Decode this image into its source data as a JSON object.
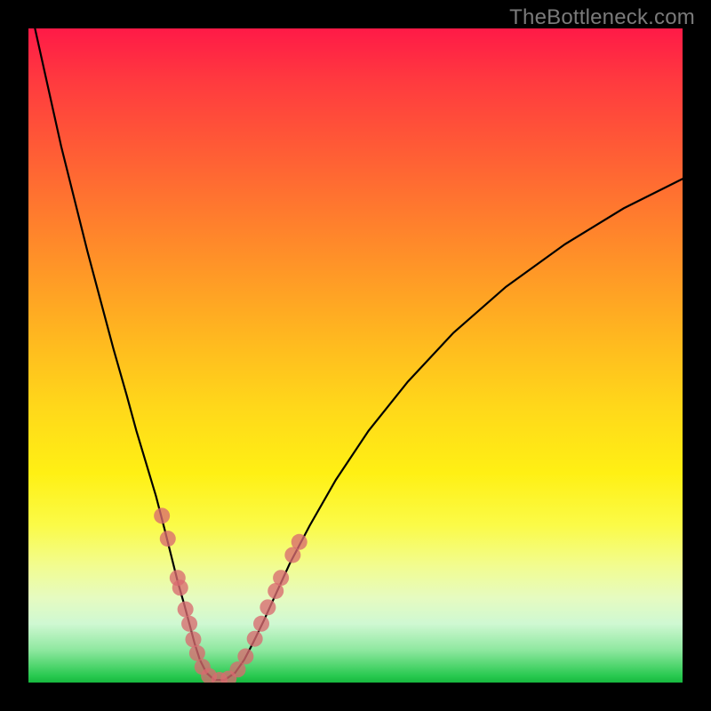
{
  "watermark": "TheBottleneck.com",
  "chart_data": {
    "type": "line",
    "title": "",
    "xlabel": "",
    "ylabel": "",
    "x_range": [
      0,
      1
    ],
    "y_range": [
      0,
      1
    ],
    "curve": [
      {
        "x": 0.01,
        "y": 1.0
      },
      {
        "x": 0.03,
        "y": 0.91
      },
      {
        "x": 0.05,
        "y": 0.82
      },
      {
        "x": 0.07,
        "y": 0.74
      },
      {
        "x": 0.09,
        "y": 0.66
      },
      {
        "x": 0.11,
        "y": 0.585
      },
      {
        "x": 0.13,
        "y": 0.51
      },
      {
        "x": 0.15,
        "y": 0.44
      },
      {
        "x": 0.165,
        "y": 0.385
      },
      {
        "x": 0.18,
        "y": 0.335
      },
      {
        "x": 0.195,
        "y": 0.285
      },
      {
        "x": 0.208,
        "y": 0.235
      },
      {
        "x": 0.218,
        "y": 0.195
      },
      {
        "x": 0.228,
        "y": 0.155
      },
      {
        "x": 0.238,
        "y": 0.12
      },
      {
        "x": 0.246,
        "y": 0.09
      },
      {
        "x": 0.254,
        "y": 0.06
      },
      {
        "x": 0.262,
        "y": 0.035
      },
      {
        "x": 0.272,
        "y": 0.015
      },
      {
        "x": 0.284,
        "y": 0.004
      },
      {
        "x": 0.3,
        "y": 0.004
      },
      {
        "x": 0.316,
        "y": 0.015
      },
      {
        "x": 0.33,
        "y": 0.035
      },
      {
        "x": 0.344,
        "y": 0.062
      },
      {
        "x": 0.36,
        "y": 0.095
      },
      {
        "x": 0.378,
        "y": 0.135
      },
      {
        "x": 0.4,
        "y": 0.183
      },
      {
        "x": 0.43,
        "y": 0.24
      },
      {
        "x": 0.47,
        "y": 0.31
      },
      {
        "x": 0.52,
        "y": 0.385
      },
      {
        "x": 0.58,
        "y": 0.46
      },
      {
        "x": 0.65,
        "y": 0.535
      },
      {
        "x": 0.73,
        "y": 0.605
      },
      {
        "x": 0.82,
        "y": 0.67
      },
      {
        "x": 0.91,
        "y": 0.725
      },
      {
        "x": 1.0,
        "y": 0.77
      }
    ],
    "dots_left": [
      {
        "x": 0.204,
        "y": 0.255
      },
      {
        "x": 0.213,
        "y": 0.22
      },
      {
        "x": 0.228,
        "y": 0.16
      },
      {
        "x": 0.232,
        "y": 0.145
      },
      {
        "x": 0.24,
        "y": 0.112
      },
      {
        "x": 0.246,
        "y": 0.09
      },
      {
        "x": 0.252,
        "y": 0.066
      },
      {
        "x": 0.258,
        "y": 0.045
      },
      {
        "x": 0.266,
        "y": 0.024
      },
      {
        "x": 0.276,
        "y": 0.01
      },
      {
        "x": 0.292,
        "y": 0.004
      }
    ],
    "dots_right": [
      {
        "x": 0.306,
        "y": 0.006
      },
      {
        "x": 0.32,
        "y": 0.02
      },
      {
        "x": 0.332,
        "y": 0.04
      },
      {
        "x": 0.346,
        "y": 0.067
      },
      {
        "x": 0.356,
        "y": 0.09
      },
      {
        "x": 0.366,
        "y": 0.115
      },
      {
        "x": 0.378,
        "y": 0.14
      },
      {
        "x": 0.386,
        "y": 0.16
      },
      {
        "x": 0.404,
        "y": 0.195
      },
      {
        "x": 0.414,
        "y": 0.215
      }
    ],
    "gradient_stops": [
      {
        "pos": 0.0,
        "color": "#ff1a47"
      },
      {
        "pos": 0.5,
        "color": "#ffd81a"
      },
      {
        "pos": 0.8,
        "color": "#fbfb48"
      },
      {
        "pos": 1.0,
        "color": "#17b83f"
      }
    ]
  }
}
